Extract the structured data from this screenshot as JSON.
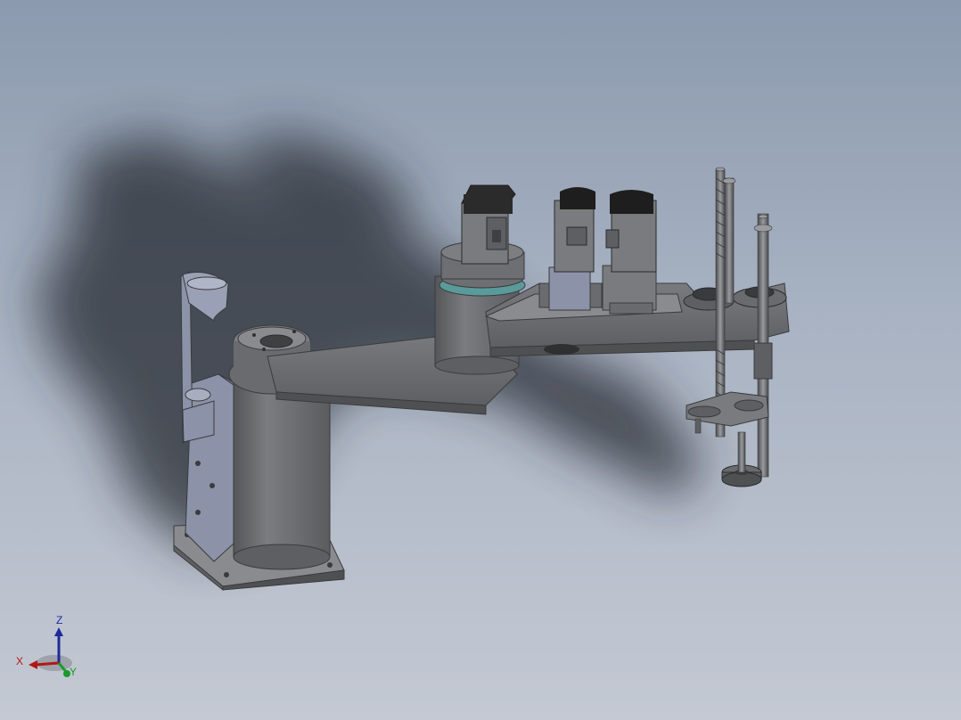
{
  "viewport": {
    "background_top": "#8b9aae",
    "background_bottom": "#c4c9d3",
    "model": "scara-robot-assembly"
  },
  "triad": {
    "x_label": "X",
    "y_label": "Y",
    "z_label": "Z",
    "x_color": "#b01818",
    "y_color": "#1a9a2a",
    "z_color": "#1c2a9a"
  },
  "colors": {
    "body": "#6f7073",
    "body_dark": "#4f5052",
    "body_light": "#8a8b8e",
    "motor": "#2b2b2c",
    "accent_ring": "#5a9a9a",
    "panel": "#8c92a8",
    "shadow": "#2c3038"
  }
}
